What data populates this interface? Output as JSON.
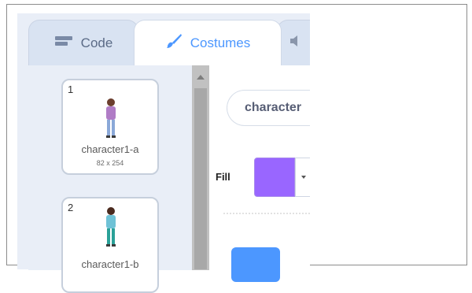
{
  "tabs": [
    {
      "label": "Code",
      "icon": "code-blocks-icon"
    },
    {
      "label": "Costumes",
      "icon": "paintbrush-icon",
      "active": true
    },
    {
      "label": "",
      "icon": "speaker-icon"
    }
  ],
  "costumes": [
    {
      "number": "1",
      "name": "character1-a",
      "size": "82 x 254",
      "selected": true
    },
    {
      "number": "2",
      "name": "character1-b",
      "size": ""
    }
  ],
  "editor": {
    "costume_name": "character",
    "fill_label": "Fill",
    "fill_color": "#9966ff"
  },
  "colors": {
    "accent": "#4c97ff",
    "panel_bg": "#e9eef7"
  }
}
